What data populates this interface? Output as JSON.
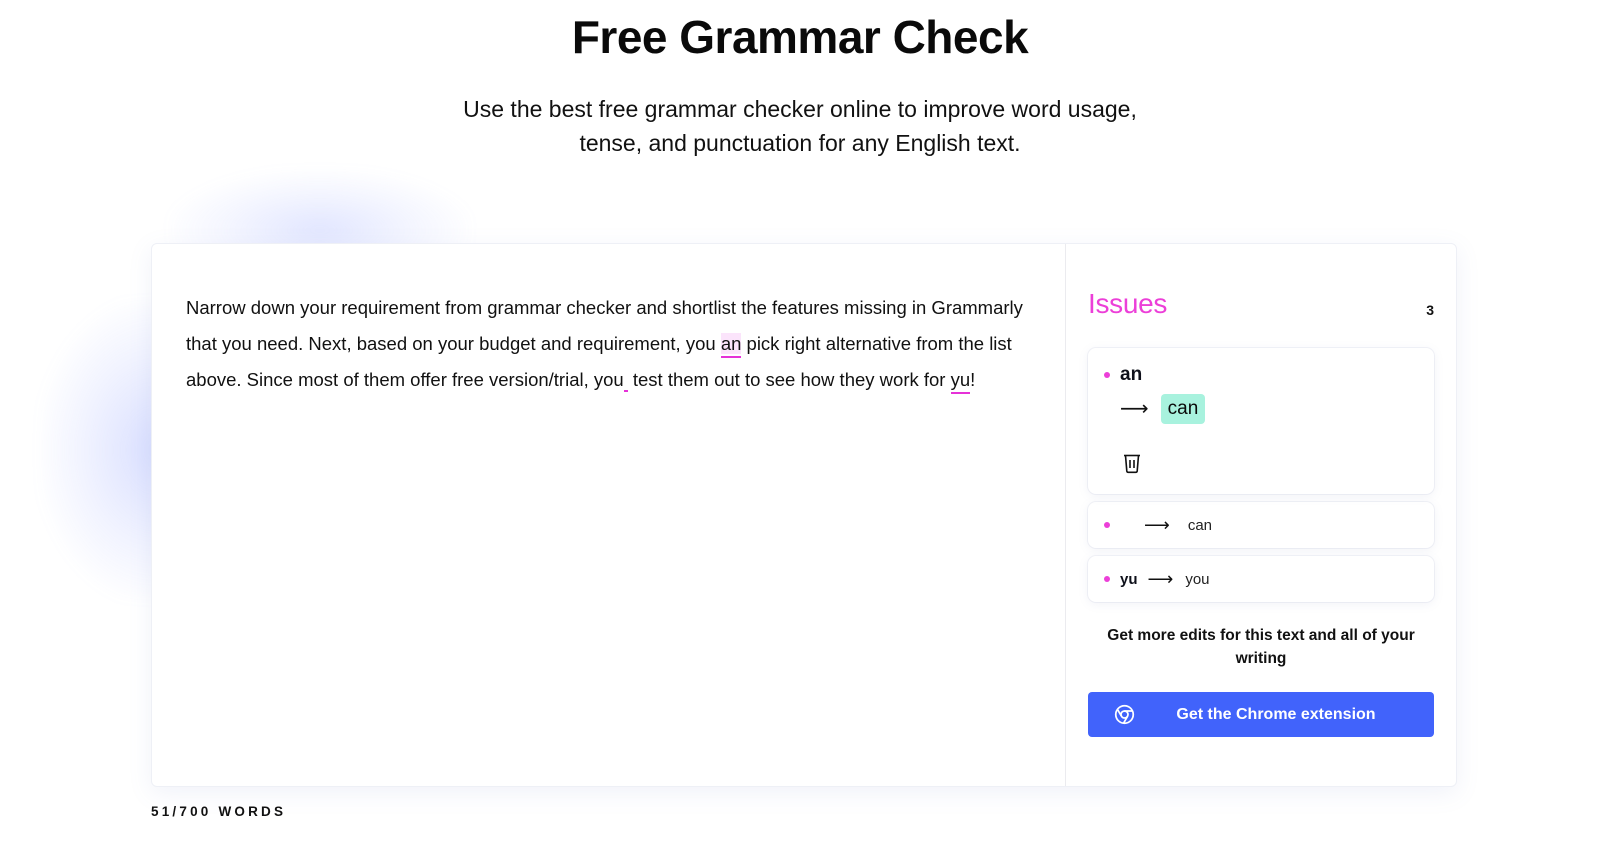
{
  "header": {
    "title": "Free Grammar Check",
    "subtitle_line1": "Use the best free grammar checker online to improve word usage,",
    "subtitle_line2": "tense, and punctuation for any English text."
  },
  "editor": {
    "segments": {
      "s1": "Narrow down your requirement from grammar checker and shortlist the features missing in Grammarly that you need. Next, based on your budget and requirement, you ",
      "e1": "an",
      "s2": " pick right alternative from the list above. Since most of them offer free version/trial, you",
      "s3": " test them out to see how they work for ",
      "e3": "yu",
      "s4": "!"
    }
  },
  "issues": {
    "title": "Issues",
    "count": "3",
    "items": [
      {
        "original": "an",
        "replacement": "can",
        "state": "expanded",
        "delete_icon": "trash-icon"
      },
      {
        "original": "",
        "replacement": "can",
        "state": "collapsed"
      },
      {
        "original": "yu",
        "replacement": "you",
        "state": "collapsed"
      }
    ],
    "arrow_glyph": "⟶",
    "accent_color": "#ec3fd8",
    "suggestion_bg": "#a8f2de"
  },
  "promo": {
    "text": "Get more edits for this text and all of your writing",
    "button_label": "Get the Chrome extension",
    "button_icon": "chrome-icon",
    "button_color": "#4163fb"
  },
  "footer": {
    "word_count": "51/700 WORDS"
  }
}
